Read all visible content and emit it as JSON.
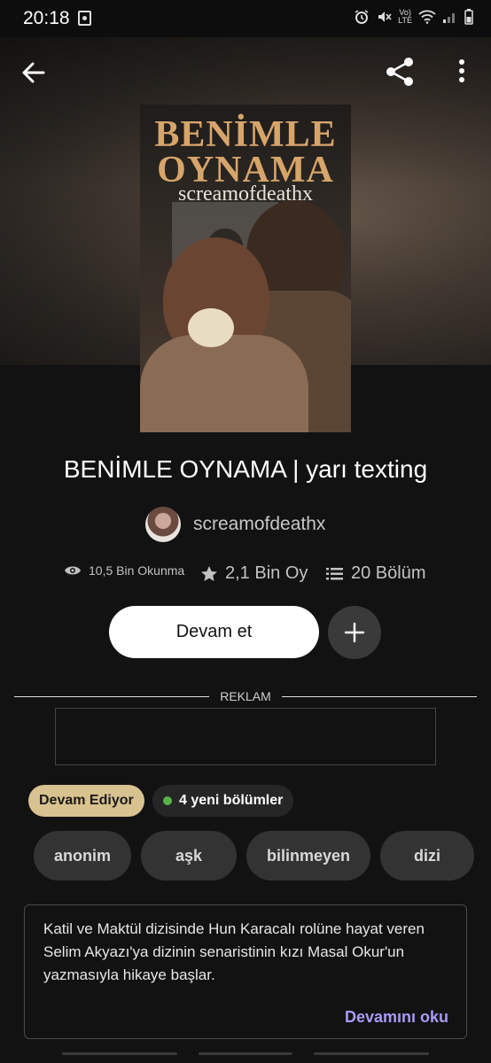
{
  "status_bar": {
    "time": "20:18",
    "icons": [
      "gallery-notification-icon",
      "alarm-icon",
      "mute-icon",
      "volte-lte-icon",
      "wifi-icon",
      "signal-icon",
      "battery-icon"
    ],
    "lte_top": "Vo)",
    "lte_bottom": "LTE"
  },
  "toolbar": {
    "back_icon": "arrow-left-icon",
    "share_icon": "share-icon",
    "more_icon": "more-vertical-icon"
  },
  "cover": {
    "title_line1": "BENİMLE",
    "title_line2": "OYNAMA",
    "author": "screamofdeathx",
    "title_color": "#d7a56a"
  },
  "book": {
    "title": "BENİMLE OYNAMA | yarı texting",
    "author": "screamofdeathx"
  },
  "stats": {
    "reads": "10,5 Bin Okunma",
    "votes": "2,1 Bin Oy",
    "parts": "20 Bölüm"
  },
  "actions": {
    "continue_label": "Devam et",
    "add_icon": "plus-icon"
  },
  "ad": {
    "label": "REKLAM"
  },
  "status_tags": {
    "ongoing": "Devam Ediyor",
    "new_parts": "4 yeni bölümler",
    "ongoing_color": "#d8c28f",
    "new_dot_color": "#5ab34a"
  },
  "tags": [
    "anonim",
    "aşk",
    "bilinmeyen",
    "dizi"
  ],
  "description": {
    "text": "Katil ve Maktül dizisinde Hun Karacalı rolüne hayat veren Selim Akyazı'ya dizinin senaristinin kızı Masal Okur'un yazmasıyla hikaye başlar.",
    "read_more": "Devamını oku",
    "read_more_color": "#a99af5"
  }
}
